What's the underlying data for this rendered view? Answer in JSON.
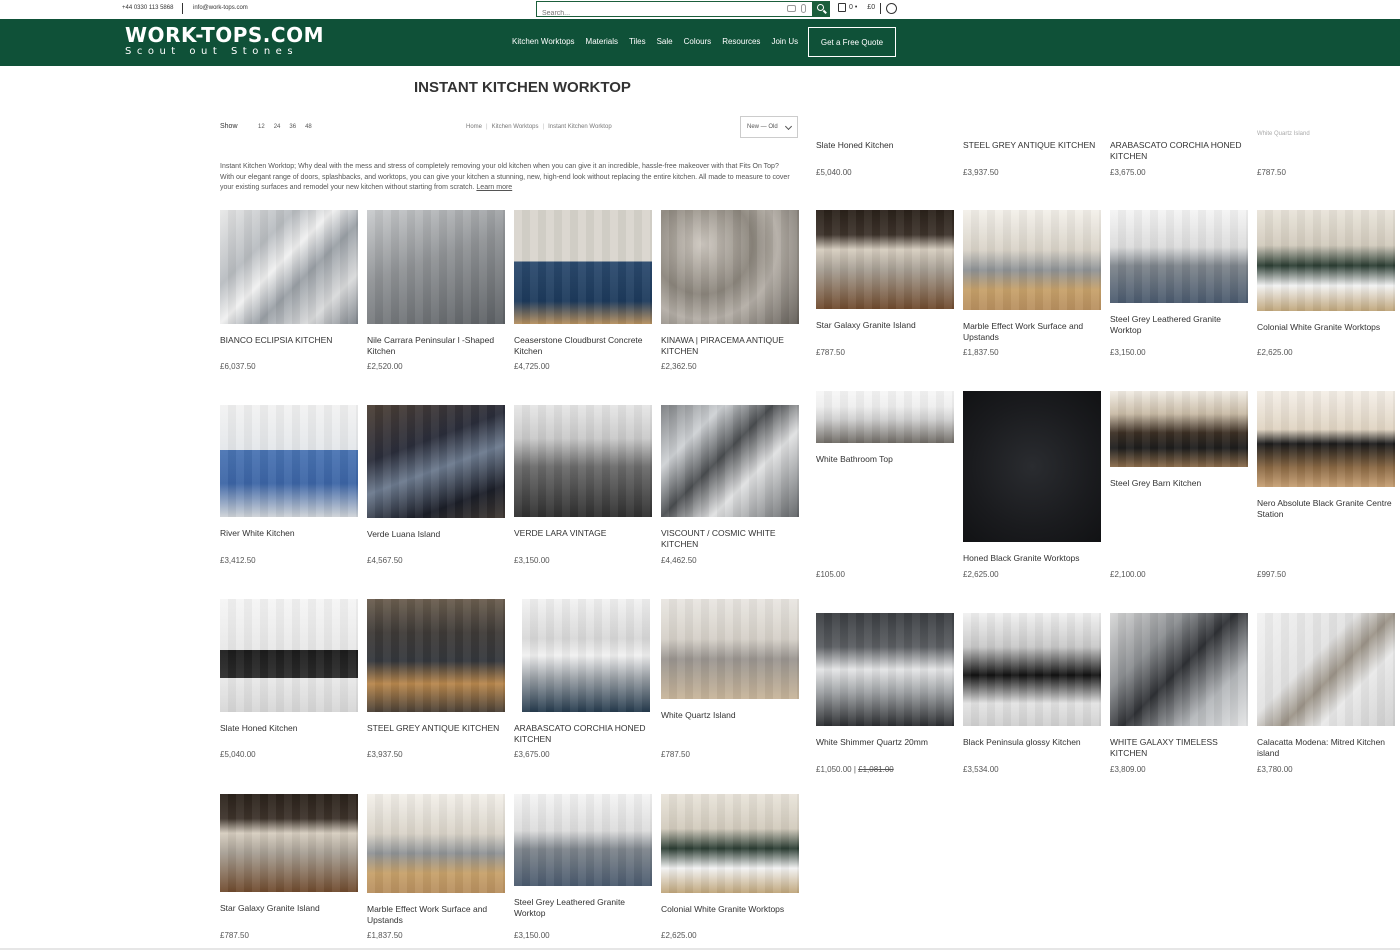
{
  "topbar": {
    "phone": "+44 0330 113 5868",
    "email": "info@work-tops.com",
    "search_placeholder": "Search...",
    "cart_count": "0 •",
    "cart_total": "£0"
  },
  "header": {
    "logo_name": "WORK-TOPS.COM",
    "logo_tag": "Scout out Stones",
    "nav": [
      "Kitchen Worktops",
      "Materials",
      "Tiles",
      "Sale",
      "Colours",
      "Resources",
      "Join Us"
    ],
    "quote_label": "Get a Free Quote"
  },
  "page": {
    "title": "INSTANT KITCHEN WORKTOP",
    "show_label": "Show",
    "show_options": [
      "12",
      "24",
      "36",
      "48"
    ],
    "breadcrumb": [
      "Home",
      "Kitchen Worktops",
      "Instant Kitchen Worktop"
    ],
    "sort_label": "New — Old",
    "intro": "Instant Kitchen Worktop; Why deal with the mess and stress of completely removing your old kitchen when you can give it an incredible, hassle-free makeover with that Fits On Top? With our elegant range of doors, splashbacks, and worktops, you can give your kitchen a stunning, new, high-end look without replacing the entire kitchen. All made to measure to cover your existing surfaces and remodel your new kitchen without starting from scratch.",
    "intro_more": "Learn more"
  },
  "colors": {
    "brand_green": "#0f5138",
    "search_green": "#1b5e3b"
  },
  "left_products": [
    {
      "name": "BIANCO ECLIPSIA KITCHEN",
      "price": "£6,037.50"
    },
    {
      "name": "Nile Carrara Peninsular l -Shaped Kitchen",
      "price": "£2,520.00"
    },
    {
      "name": "Ceaserstone Cloudburst Concrete Kitchen",
      "price": "£4,725.00"
    },
    {
      "name": "KINAWA | PIRACEMA ANTIQUE KITCHEN",
      "price": "£2,362.50"
    },
    {
      "name": "River White Kitchen",
      "price": "£3,412.50"
    },
    {
      "name": "Verde Luana Island",
      "price": "£4,567.50"
    },
    {
      "name": "VERDE LARA VINTAGE",
      "price": "£3,150.00"
    },
    {
      "name": "VISCOUNT / COSMIC WHITE KITCHEN",
      "price": "£4,462.50"
    },
    {
      "name": "Slate Honed Kitchen",
      "price": "£5,040.00"
    },
    {
      "name": "STEEL GREY ANTIQUE KITCHEN",
      "price": "£3,937.50"
    },
    {
      "name": "ARABASCATO CORCHIA HONED KITCHEN",
      "price": "£3,675.00"
    },
    {
      "name": "White Quartz Island",
      "price": "£787.50"
    },
    {
      "name": "Star Galaxy Granite Island",
      "price": "£787.50"
    },
    {
      "name": "Marble Effect Work Surface and Upstands",
      "price": "£1,837.50"
    },
    {
      "name": "Steel Grey Leathered Granite Worktop",
      "price": "£3,150.00"
    },
    {
      "name": "Colonial White Granite Worktops",
      "price": "£2,625.00"
    }
  ],
  "right_products": [
    {
      "name": "Slate Honed Kitchen",
      "price": "£5,040.00"
    },
    {
      "name": "STEEL GREY ANTIQUE KITCHEN",
      "price": "£3,937.50"
    },
    {
      "name": "ARABASCATO CORCHIA HONED KITCHEN",
      "price": "£3,675.00"
    },
    {
      "name": "White Quartz Island",
      "price": "£787.50"
    },
    {
      "name": "Star Galaxy Granite Island",
      "price": "£787.50"
    },
    {
      "name": "Marble Effect Work Surface and Upstands",
      "price": "£1,837.50"
    },
    {
      "name": "Steel Grey Leathered Granite Worktop",
      "price": "£3,150.00"
    },
    {
      "name": "Colonial White Granite Worktops",
      "price": "£2,625.00"
    },
    {
      "name": "White Bathroom Top",
      "price": "£105.00"
    },
    {
      "name": "Honed Black Granite Worktops",
      "price": "£2,625.00"
    },
    {
      "name": "Steel Grey Barn Kitchen",
      "price": "£2,100.00"
    },
    {
      "name": "Nero Absolute Black Granite Centre Station",
      "price": "£997.50"
    },
    {
      "name": "White Shimmer Quartz 20mm",
      "price": "£1,050.00",
      "old_price": "£1,081.00"
    },
    {
      "name": "Black Peninsula glossy Kitchen",
      "price": "£3,534.00"
    },
    {
      "name": "WHITE GALAXY TIMELESS KITCHEN",
      "price": "£3,809.00"
    },
    {
      "name": "Calacatta Modena: Mitred Kitchen island",
      "price": "£3,780.00"
    }
  ]
}
